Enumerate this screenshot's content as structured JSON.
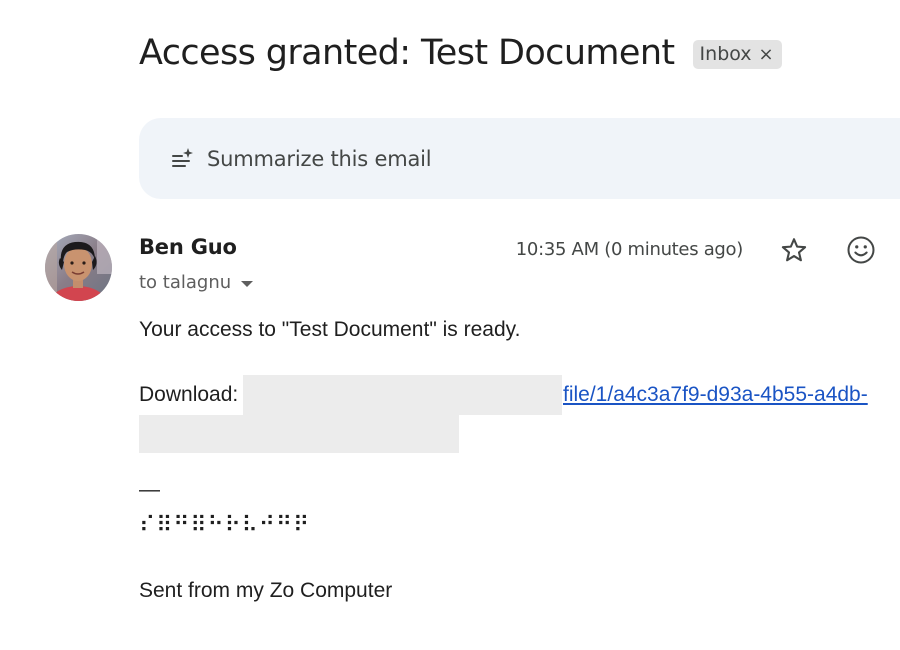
{
  "email": {
    "subject": "Access granted: Test Document",
    "label": "Inbox",
    "label_remove_glyph": "×",
    "summarize_label": "Summarize this email",
    "sender": "Ben Guo",
    "recipient_text": "to talagnu",
    "timestamp": "10:35 AM (0 minutes ago)",
    "body": {
      "line1": "Your access to \"Test Document\" is ready.",
      "download_label": "Download:",
      "link_text": "file/1/a4c3a7f9-d93a-4b55-a4db-",
      "dash": "—",
      "braille": "⠎⠿⠛⠿⠓⠗⠧⠚⠛⠟",
      "signoff": "Sent from my Zo Computer"
    }
  },
  "icons": {
    "summarize": "sparkle-lines-icon",
    "star": "star-outline-icon",
    "emoji": "emoji-reaction-icon",
    "caret": "caret-down-icon"
  },
  "colors": {
    "link": "#1a54c4",
    "summary_bg": "#f0f4f9",
    "chip_bg": "#e3e3e3",
    "redaction": "#ececec"
  }
}
